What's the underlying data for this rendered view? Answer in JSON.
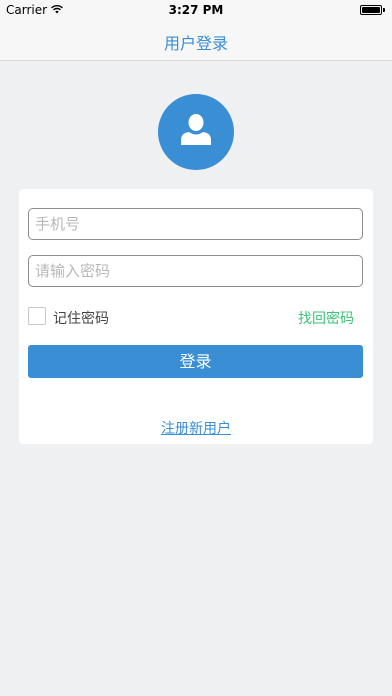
{
  "status_bar": {
    "carrier": "Carrier",
    "time": "3:27 PM",
    "battery_level": 1.0
  },
  "nav": {
    "title": "用户登录"
  },
  "avatar": {
    "icon": "user-silhouette-icon"
  },
  "form": {
    "phone_placeholder": "手机号",
    "phone_value": "",
    "password_placeholder": "请输入密码",
    "password_value": "",
    "remember_label": "记住密码",
    "remember_checked": false,
    "forgot_label": "找回密码",
    "login_label": "登录",
    "register_label": "注册新用户"
  },
  "colors": {
    "accent": "#3a8ed4",
    "forgot_link": "#3cc27a",
    "background": "#eff0f2"
  }
}
